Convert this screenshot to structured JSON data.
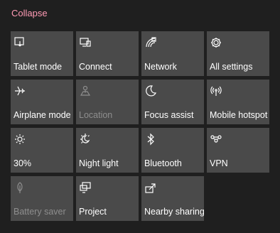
{
  "header": {
    "collapse_label": "Collapse"
  },
  "tiles": [
    {
      "label": "Tablet mode",
      "icon": "tablet-mode-icon",
      "state": "on"
    },
    {
      "label": "Connect",
      "icon": "connect-icon",
      "state": "on"
    },
    {
      "label": "Network",
      "icon": "network-icon",
      "state": "on"
    },
    {
      "label": "All settings",
      "icon": "gear-icon",
      "state": "on"
    },
    {
      "label": "Airplane mode",
      "icon": "airplane-icon",
      "state": "on"
    },
    {
      "label": "Location",
      "icon": "location-icon",
      "state": "disabled"
    },
    {
      "label": "Focus assist",
      "icon": "moon-icon",
      "state": "on"
    },
    {
      "label": "Mobile hotspot",
      "icon": "hotspot-icon",
      "state": "on"
    },
    {
      "label": "30%",
      "icon": "brightness-icon",
      "state": "on"
    },
    {
      "label": "Night light",
      "icon": "night-light-icon",
      "state": "on"
    },
    {
      "label": "Bluetooth",
      "icon": "bluetooth-icon",
      "state": "on"
    },
    {
      "label": "VPN",
      "icon": "vpn-icon",
      "state": "on"
    },
    {
      "label": "Battery saver",
      "icon": "leaf-icon",
      "state": "disabled"
    },
    {
      "label": "Project",
      "icon": "project-icon",
      "state": "on"
    },
    {
      "label": "Nearby sharing",
      "icon": "share-icon",
      "state": "on"
    }
  ],
  "colors": {
    "background": "#1f1f1f",
    "tile": "#4a4a4a",
    "accent": "#ff9bb5",
    "text": "#ffffff",
    "disabled_text": "#8e8e8e"
  }
}
